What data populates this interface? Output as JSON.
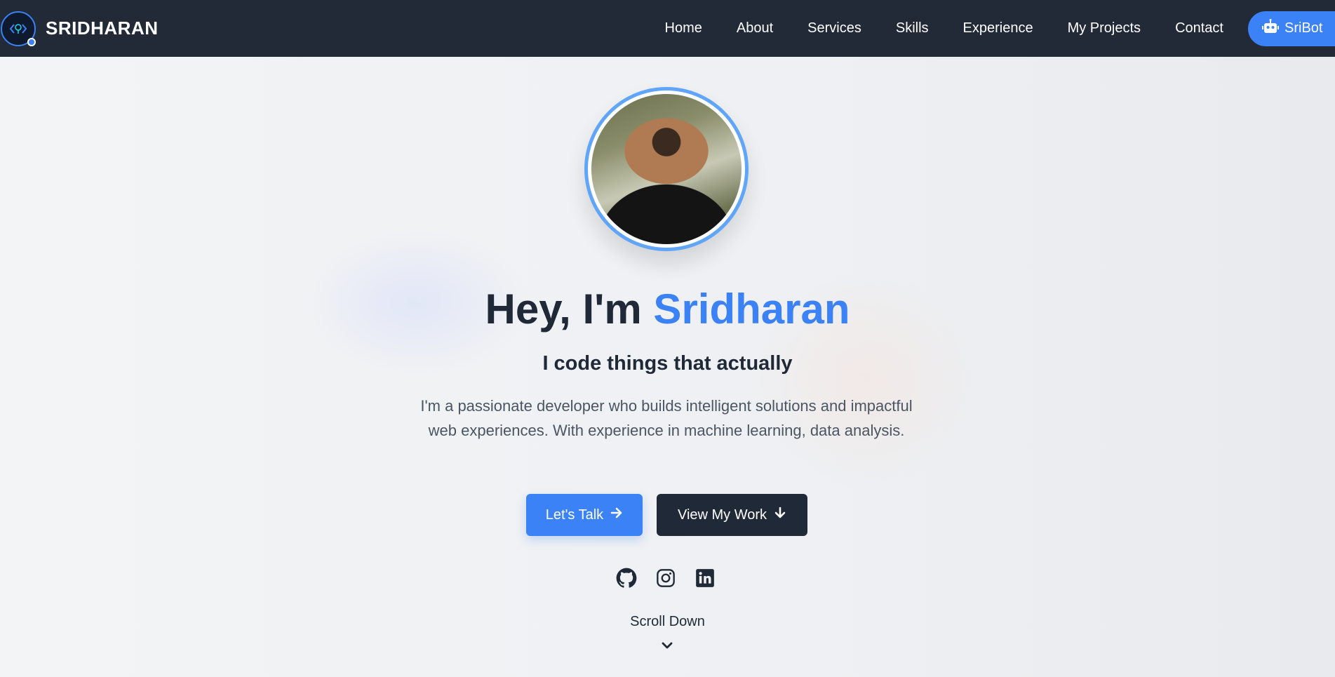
{
  "header": {
    "brand_name": "SRIDHARAN",
    "logo_icon": "code-brain-logo"
  },
  "nav": {
    "items": [
      {
        "label": "Home"
      },
      {
        "label": "About"
      },
      {
        "label": "Services"
      },
      {
        "label": "Skills"
      },
      {
        "label": "Experience"
      },
      {
        "label": "My Projects"
      },
      {
        "label": "Contact"
      }
    ],
    "bot_button": {
      "label": "SriBot",
      "icon": "robot-icon"
    }
  },
  "hero": {
    "greeting": "Hey, I'm ",
    "name": "Sridharan",
    "tagline": "I code things that actually",
    "description": "I'm a passionate developer who builds intelligent solutions and impactful web experiences. With experience in machine learning, data analysis.",
    "primary_button": {
      "label": "Let's Talk",
      "icon": "arrow-right-icon"
    },
    "secondary_button": {
      "label": "View My Work",
      "icon": "arrow-down-icon"
    },
    "socials": [
      {
        "icon": "github-icon"
      },
      {
        "icon": "instagram-icon"
      },
      {
        "icon": "linkedin-icon"
      }
    ],
    "scroll_label": "Scroll Down"
  },
  "colors": {
    "navbar": "#222a37",
    "accent": "#3b82f6",
    "dark": "#1f2937",
    "text_muted": "#4b5563"
  }
}
